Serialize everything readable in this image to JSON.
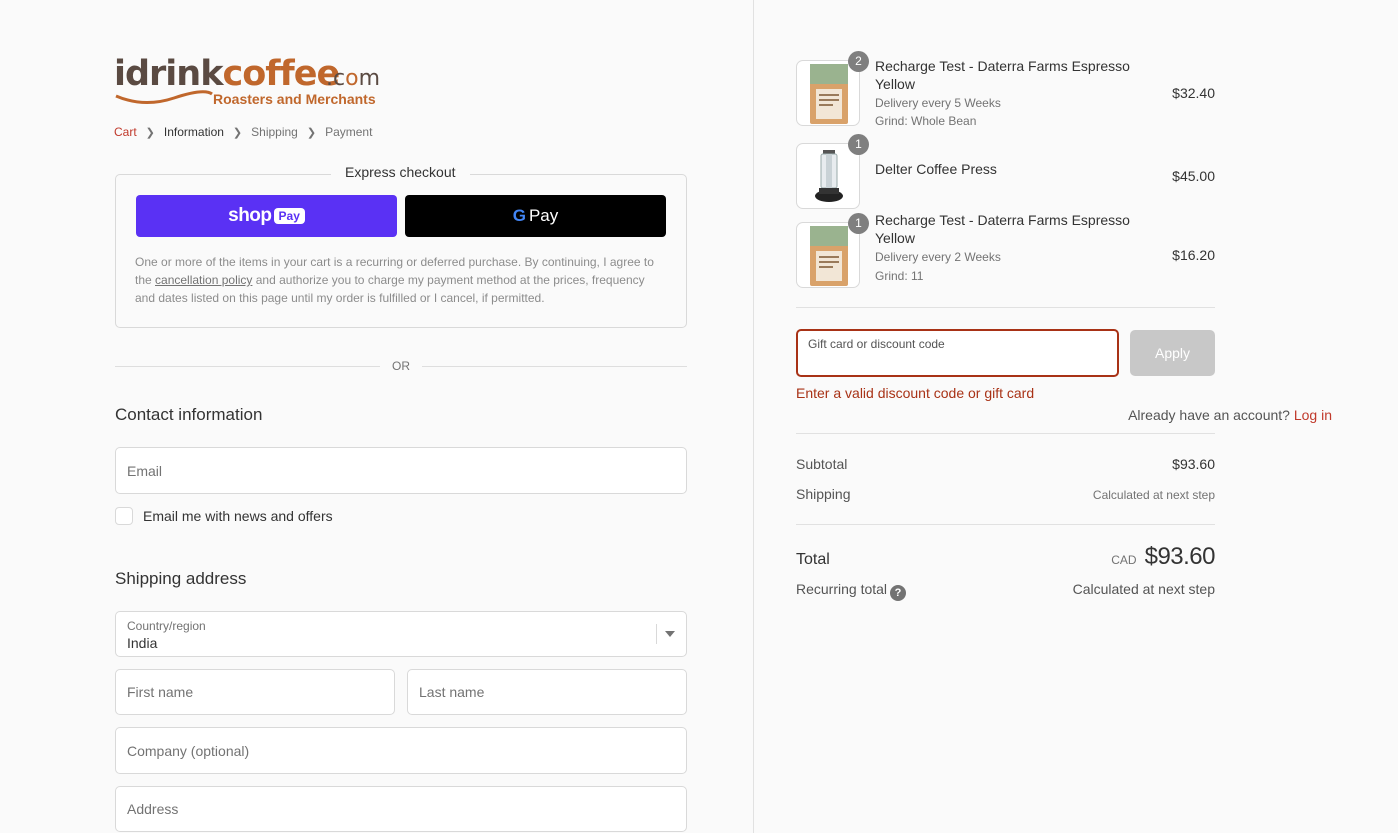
{
  "brand": {
    "logo_main_left": "idrink",
    "logo_main_right": "coffee",
    "logo_domain_dot": ".c",
    "logo_domain_o": "o",
    "logo_domain_m": "m",
    "logo_tagline": "Roasters and Merchants"
  },
  "breadcrumb": [
    {
      "label": "Cart"
    },
    {
      "label": "Information"
    },
    {
      "label": "Shipping"
    },
    {
      "label": "Payment"
    }
  ],
  "express": {
    "title": "Express checkout",
    "shoppay_shop": "shop",
    "shoppay_pay": "Pay",
    "gpay_g": "G",
    "gpay_pay": "Pay",
    "disclaimer_pre": "One or more of the items in your cart is a recurring or deferred purchase. By continuing, I agree to the ",
    "disclaimer_link": "cancellation policy",
    "disclaimer_post": " and authorize you to charge my payment method at the prices, frequency and dates listed on this page until my order is fulfilled or I cancel, if permitted."
  },
  "or_label": "OR",
  "contact": {
    "heading": "Contact information",
    "account_prompt": "Already have an account?",
    "login_label": "Log in",
    "email_placeholder": "Email",
    "newsletter_label": "Email me with news and offers"
  },
  "shipping": {
    "heading": "Shipping address",
    "country_label": "Country/region",
    "country_value": "India",
    "first_name_placeholder": "First name",
    "last_name_placeholder": "Last name",
    "company_placeholder": "Company (optional)",
    "address_placeholder": "Address"
  },
  "cart": {
    "items": [
      {
        "name": "Recharge Test - Daterra Farms Espresso Yellow",
        "quantity": "2",
        "meta1": "Delivery every 5 Weeks",
        "meta2": "Grind: Whole Bean",
        "price": "$32.40"
      },
      {
        "name": "Delter Coffee Press",
        "quantity": "1",
        "price": "$45.00"
      },
      {
        "name": "Recharge Test - Daterra Farms Espresso Yellow",
        "quantity": "1",
        "meta1": "Delivery every 2 Weeks",
        "meta2": "Grind: 11",
        "price": "$16.20"
      }
    ],
    "discount_placeholder": "Gift card or discount code",
    "apply_label": "Apply",
    "discount_error": "Enter a valid discount code or gift card",
    "subtotal_label": "Subtotal",
    "subtotal_value": "$93.60",
    "shipping_label": "Shipping",
    "shipping_value": "Calculated at next step",
    "total_label": "Total",
    "total_currency": "CAD",
    "total_value": "$93.60",
    "recurring_label": "Recurring total",
    "recurring_value": "Calculated at next step"
  },
  "colors": {
    "accent": "#c0392b",
    "error": "#a83216",
    "shoppay": "#5a31f4",
    "logo_orange": "#c0672c"
  }
}
